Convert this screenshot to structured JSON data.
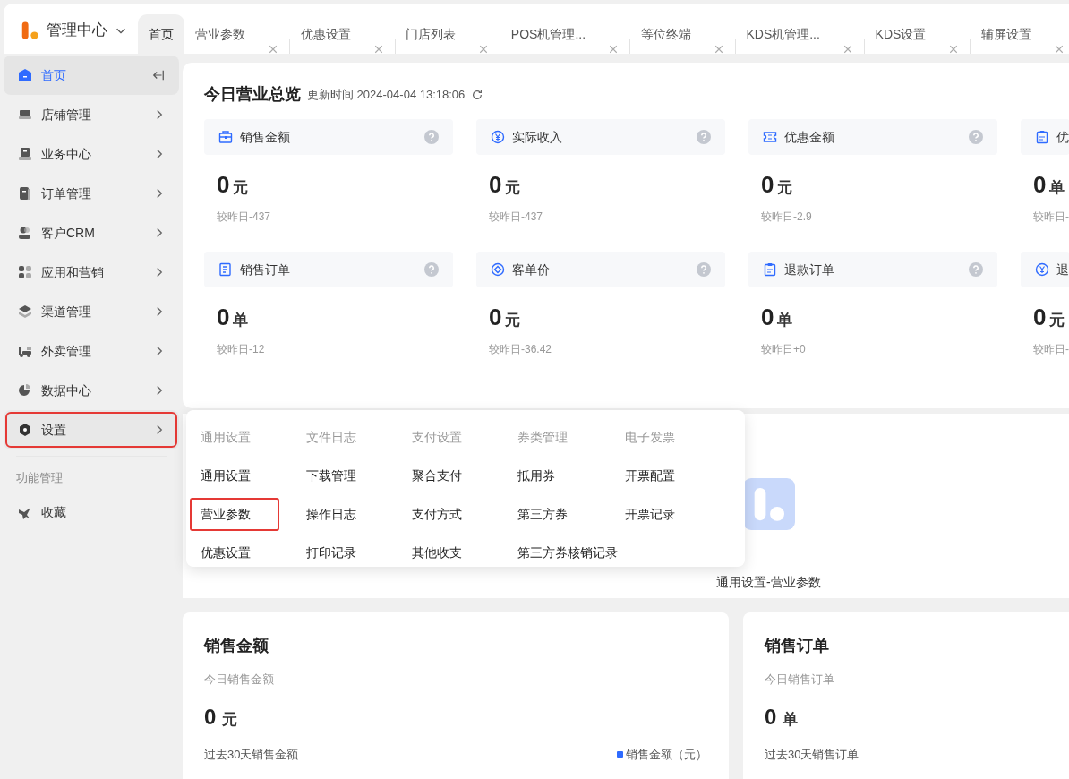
{
  "header": {
    "title": "管理中心"
  },
  "tabs": [
    {
      "label": "首页",
      "selected": true,
      "closable": false
    },
    {
      "label": "营业参数",
      "selected": false,
      "closable": true
    },
    {
      "label": "优惠设置",
      "selected": false,
      "closable": true
    },
    {
      "label": "门店列表",
      "selected": false,
      "closable": true
    },
    {
      "label": "POS机管理...",
      "selected": false,
      "closable": true
    },
    {
      "label": "等位终端",
      "selected": false,
      "closable": true
    },
    {
      "label": "KDS机管理...",
      "selected": false,
      "closable": true
    },
    {
      "label": "KDS设置",
      "selected": false,
      "closable": true
    },
    {
      "label": "辅屏设置",
      "selected": false,
      "closable": true
    }
  ],
  "sidebar": {
    "items": [
      {
        "label": "首页",
        "selected": true,
        "highlighted": false
      },
      {
        "label": "店铺管理",
        "selected": false,
        "highlighted": false
      },
      {
        "label": "业务中心",
        "selected": false,
        "highlighted": false
      },
      {
        "label": "订单管理",
        "selected": false,
        "highlighted": false
      },
      {
        "label": "客户CRM",
        "selected": false,
        "highlighted": false
      },
      {
        "label": "应用和营销",
        "selected": false,
        "highlighted": false
      },
      {
        "label": "渠道管理",
        "selected": false,
        "highlighted": false
      },
      {
        "label": "外卖管理",
        "selected": false,
        "highlighted": false
      },
      {
        "label": "数据中心",
        "selected": false,
        "highlighted": false
      },
      {
        "label": "设置",
        "selected": false,
        "highlighted": true
      }
    ],
    "section_label": "功能管理",
    "extra_items": [
      {
        "label": "收藏"
      }
    ]
  },
  "overview": {
    "title": "今日营业总览",
    "updated": "更新时间 2024-04-04 13:18:06",
    "cards": [
      {
        "label": "销售金额",
        "value": "0",
        "unit": "元",
        "compare": "较昨日-437"
      },
      {
        "label": "实际收入",
        "value": "0",
        "unit": "元",
        "compare": "较昨日-437"
      },
      {
        "label": "优惠金额",
        "value": "0",
        "unit": "元",
        "compare": "较昨日-2.9"
      },
      {
        "label": "优",
        "value": "0",
        "unit": "单",
        "compare": "较昨日-"
      },
      {
        "label": "销售订单",
        "value": "0",
        "unit": "单",
        "compare": "较昨日-12"
      },
      {
        "label": "客单价",
        "value": "0",
        "unit": "元",
        "compare": "较昨日-36.42"
      },
      {
        "label": "退款订单",
        "value": "0",
        "unit": "单",
        "compare": "较昨日+0"
      },
      {
        "label": "退",
        "value": "0",
        "unit": "元",
        "compare": "较昨日-"
      }
    ]
  },
  "settings_menu": {
    "columns": [
      {
        "heading": "通用设置",
        "items": [
          {
            "label": "通用设置",
            "highlighted": false
          },
          {
            "label": "营业参数",
            "highlighted": true
          },
          {
            "label": "优惠设置",
            "highlighted": false
          }
        ]
      },
      {
        "heading": "文件日志",
        "items": [
          {
            "label": "下载管理",
            "highlighted": false
          },
          {
            "label": "操作日志",
            "highlighted": false
          },
          {
            "label": "打印记录",
            "highlighted": false
          }
        ]
      },
      {
        "heading": "支付设置",
        "items": [
          {
            "label": "聚合支付",
            "highlighted": false
          },
          {
            "label": "支付方式",
            "highlighted": false
          },
          {
            "label": "其他收支",
            "highlighted": false
          }
        ]
      },
      {
        "heading": "券类管理",
        "items": [
          {
            "label": "抵用券",
            "highlighted": false
          },
          {
            "label": "第三方券",
            "highlighted": false
          },
          {
            "label": "第三方券核销记录",
            "highlighted": false
          }
        ]
      },
      {
        "heading": "电子发票",
        "items": [
          {
            "label": "开票配置",
            "highlighted": false
          },
          {
            "label": "开票记录",
            "highlighted": false
          }
        ]
      }
    ]
  },
  "shortcut": {
    "label": "通用设置-营业参数"
  },
  "panels": [
    {
      "title": "销售金额",
      "subtitle": "今日销售金额",
      "value": "0",
      "unit": "元",
      "period": "过去30天销售金额",
      "legend": {
        "label": "销售金额（元）",
        "color": "#2f6bff"
      }
    },
    {
      "title": "销售订单",
      "subtitle": "今日销售订单",
      "value": "0",
      "unit": "单",
      "period": "过去30天销售订单"
    }
  ]
}
